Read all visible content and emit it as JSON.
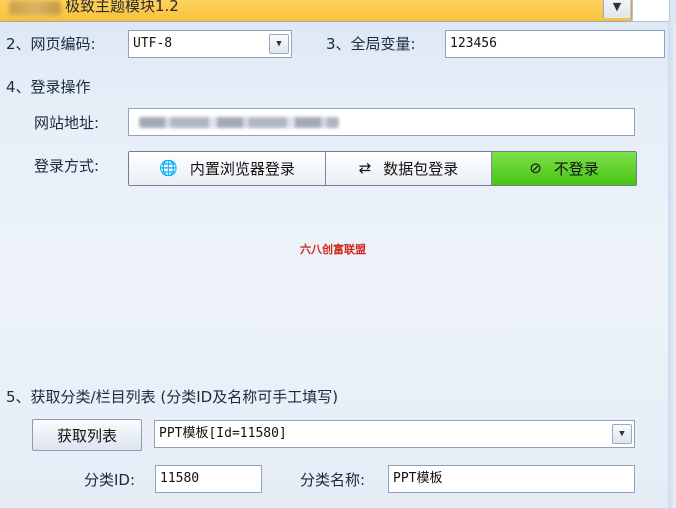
{
  "module": {
    "title": "极致主题模块1.2"
  },
  "row2": {
    "encoding_label": "2、网页编码:",
    "encoding_value": "UTF-8",
    "global_label": "3、全局变量:",
    "global_value": "123456"
  },
  "login": {
    "section_title": "4、登录操作",
    "site_label": "网站地址:",
    "method_label": "登录方式:",
    "options": [
      {
        "label": "内置浏览器登录",
        "icon": "globe-icon"
      },
      {
        "label": "数据包登录",
        "icon": "shuffle-icon"
      },
      {
        "label": "不登录",
        "icon": "no-entry-icon"
      }
    ],
    "selected": "不登录"
  },
  "watermark": "六八创富联盟",
  "category": {
    "section_title": "5、获取分类/栏目列表 (分类ID及名称可手工填写)",
    "fetch_button": "获取列表",
    "selected_option": "PPT模板[Id=11580]",
    "id_label": "分类ID:",
    "id_value": "11580",
    "name_label": "分类名称:",
    "name_value": "PPT模板"
  },
  "colors": {
    "accent_selected": "#5ccb26",
    "module_bar": "#f8c13a",
    "watermark": "#d2281e"
  }
}
